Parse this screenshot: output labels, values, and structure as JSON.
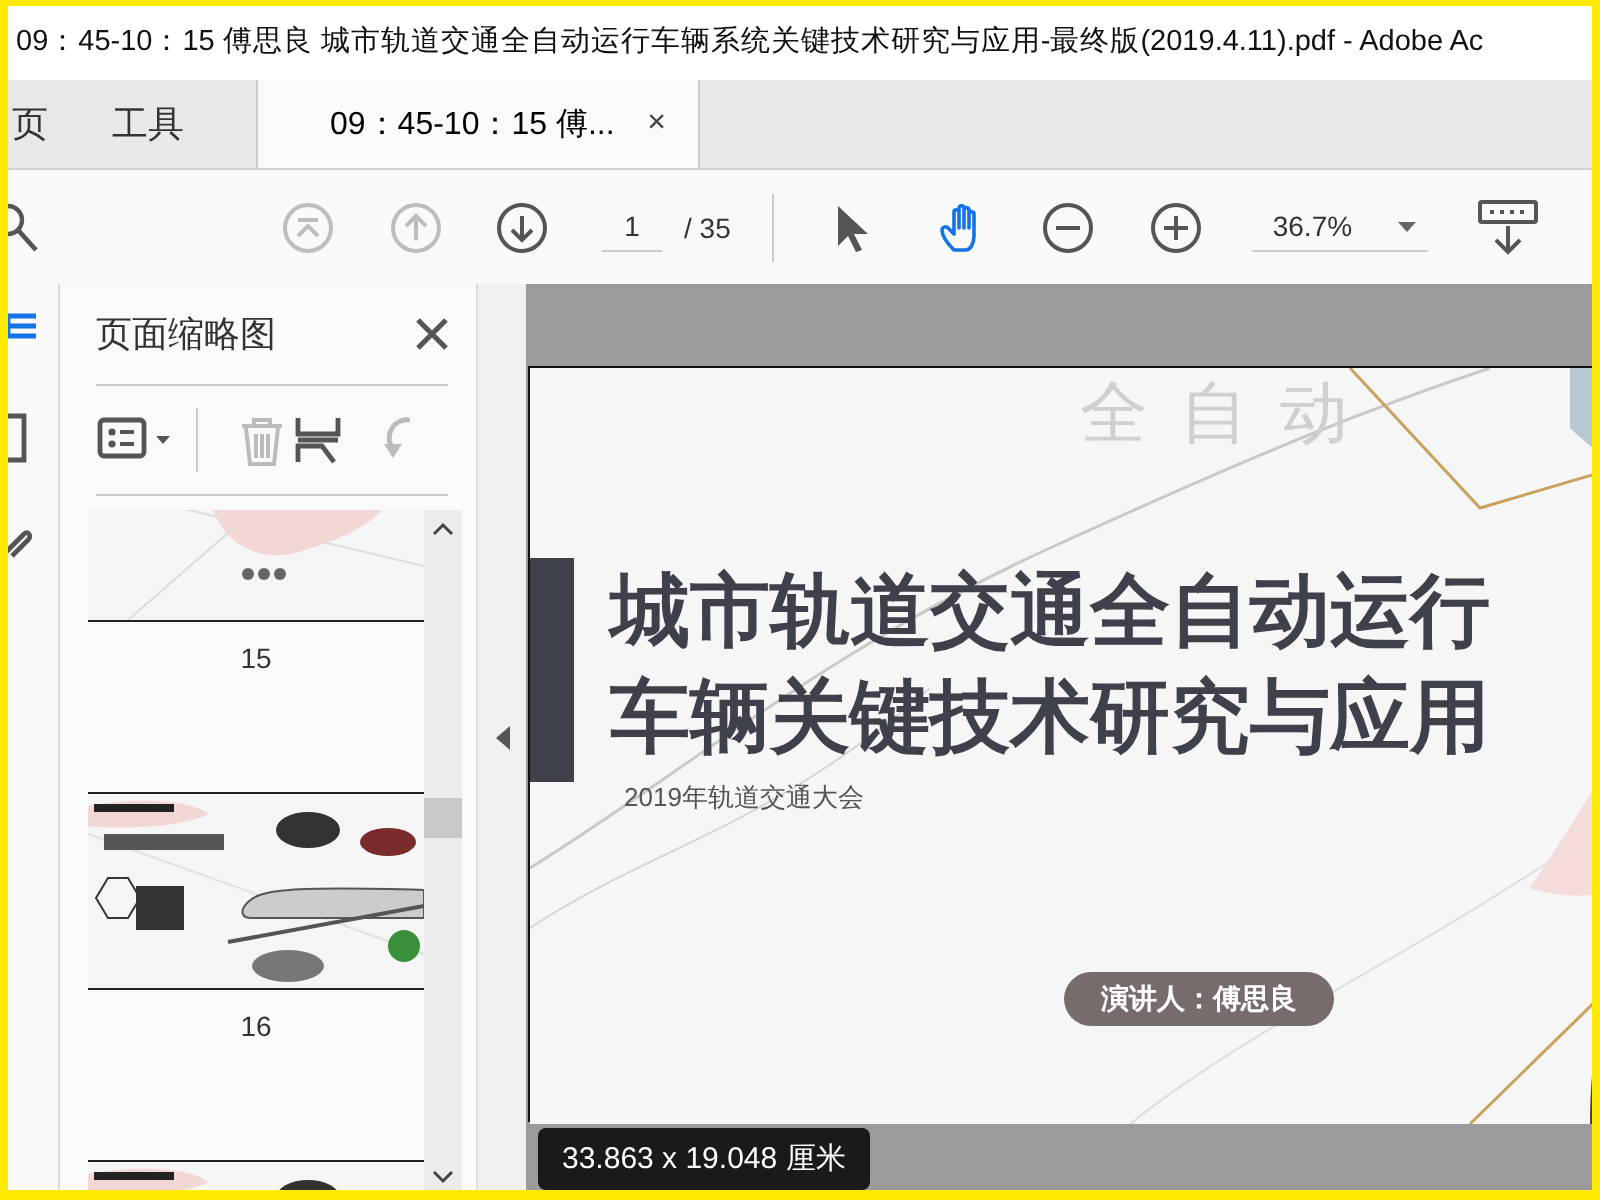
{
  "window": {
    "title": "09：45-10：15  傅思良  城市轨道交通全自动运行车辆系统关键技术研究与应用-最终版(2019.4.11).pdf - Adobe Ac"
  },
  "tabs": [
    {
      "label": "页",
      "kind": "nav",
      "selected": false
    },
    {
      "label": "工具",
      "kind": "nav",
      "selected": false
    },
    {
      "label": "09：45-10：15  傅...",
      "kind": "document",
      "selected": true,
      "close": "×"
    }
  ],
  "toolbar": {
    "tools": [
      {
        "kind": "first",
        "disabled": true
      },
      {
        "kind": "prev",
        "disabled": true
      },
      {
        "kind": "next",
        "disabled": false
      }
    ],
    "page": "1",
    "page_total": "/ 35",
    "modes": [
      {
        "kind": "select",
        "selected": false
      },
      {
        "kind": "hand",
        "selected": true
      }
    ],
    "zoom": "36.7%"
  },
  "nav_rail": [
    {
      "kind": "pages",
      "selected": true
    },
    {
      "kind": "bookmarks",
      "selected": false
    },
    {
      "kind": "attachments",
      "selected": false
    }
  ],
  "thumbnail_panel": {
    "title": "页面缩略图",
    "tools": [
      {
        "kind": "options",
        "disabled": false
      },
      {
        "kind": "delete",
        "disabled": true
      },
      {
        "kind": "insert",
        "disabled": false
      },
      {
        "kind": "rotate",
        "disabled": true
      }
    ],
    "thumbnails": [
      {
        "kind": "closing",
        "label": "15"
      },
      {
        "kind": "train",
        "label": "16"
      },
      {
        "kind": "train"
      }
    ]
  },
  "document": {
    "slide": {
      "deco_text": "全自动",
      "title_lines": [
        "城市轨道交通全自动运行",
        "车辆关键技术研究与应用"
      ],
      "subtitle": "2019年轨道交通大会",
      "speaker": "演讲人：傅思良"
    },
    "page_size": "33.863 x 19.048 厘米"
  }
}
